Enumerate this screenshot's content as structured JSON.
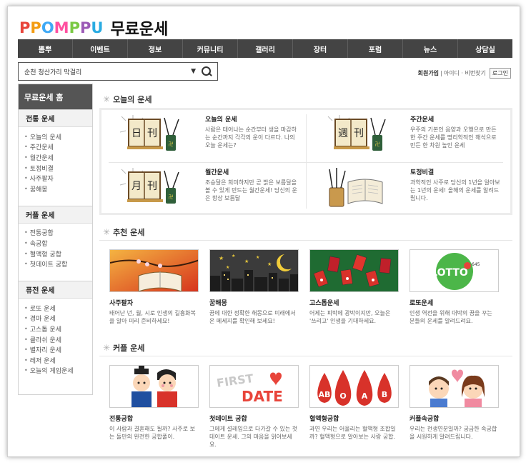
{
  "header": {
    "logo_letters": [
      "P",
      "P",
      "O",
      "M",
      "P",
      "P",
      "U"
    ],
    "logo_colors": [
      "#e8443a",
      "#f39c12",
      "#3fa9f5",
      "#ff4fa0",
      "#7ac943",
      "#9b59b6",
      "#29abe2"
    ],
    "site_title": "무료운세"
  },
  "nav": [
    "뽐뿌",
    "이벤트",
    "정보",
    "커뮤니티",
    "갤러리",
    "장터",
    "포럼",
    "뉴스",
    "상담실"
  ],
  "search": {
    "value": "순천 청산가리 막걸리"
  },
  "member": {
    "join": "회원가입",
    "find": "아이디 · 비번찾기",
    "login": "로그인"
  },
  "sidebar": {
    "home": "무료운세 홈",
    "groups": [
      {
        "title": "전통 운세",
        "items": [
          "오늘의 운세",
          "주간운세",
          "월간운세",
          "토정비결",
          "사주팔자",
          "꿈해몽"
        ]
      },
      {
        "title": "커플 운세",
        "items": [
          "전통궁합",
          "속궁합",
          "혈액형 궁합",
          "첫데이트 궁합"
        ]
      },
      {
        "title": "퓨전 운세",
        "items": [
          "로또 운세",
          "경마 운세",
          "고스톱 운세",
          "클라쉬 운세",
          "별자리 운세",
          "레저 운세",
          "오늘의 게임운세"
        ]
      }
    ]
  },
  "sections": {
    "today": "오늘의 운세",
    "recommend": "추천 운세",
    "couple": "커플 운세"
  },
  "today": [
    {
      "name": "오늘의 운세",
      "desc": "사람은 태어나는 순간부터 생을 마감하는 순간까지 각각의 운이 다르다. 나의 오늘 운세는?",
      "chars": [
        "日",
        "刊"
      ]
    },
    {
      "name": "주간운세",
      "desc": "우주의 기본인 음양과 오행으로 만든 한 주간 운세를 명리학적인 해석으로 만든 한 차원 높인 운세",
      "chars": [
        "週",
        "刊"
      ]
    },
    {
      "name": "월간운세",
      "desc": "조승달은 희미하지만 곧 밝은 보름달을 볼 수 있게 만드는 월간운세! 당신의 운은 항상 보름달",
      "chars": [
        "月",
        "刊"
      ]
    },
    {
      "name": "토정비결",
      "desc": "과학적인 사주로 당신의 1년을 알아보는 1년의 운세! 올해의 운세를 알려드립니다.",
      "chars": []
    }
  ],
  "recommend": [
    {
      "name": "사주팔자",
      "desc": "태어난 년, 월, 시로 인생의 길흉화복을 알아 미리 준비하세요!"
    },
    {
      "name": "꿈해몽",
      "desc": "꿈에 대한 정확한 해몽으로 미래에서 온 메세지를 확인해 보세요!"
    },
    {
      "name": "고스톱운세",
      "desc": "어제는 피박에 광박이지만, 오늘은 '쓰리고' 인생을 기대하세요."
    },
    {
      "name": "로또운세",
      "desc": "인생 역전을 위해 대박의 꿈을 꾸는 분들의 운세를 알려드려요."
    }
  ],
  "recommend_thumb_text": {
    "lotto": "LOTTO",
    "lotto_num": "645"
  },
  "couple": [
    {
      "name": "전통궁합",
      "desc": "이 사람과 결혼해도 될까? 사주로 보는 둘만의 완전한 궁합풀이."
    },
    {
      "name": "첫데이트 궁합",
      "desc": "그에게 설레임으로 다가갈 수 있는 첫 데이트 운세. 그의 마음을 읽어보세요."
    },
    {
      "name": "혈액형궁합",
      "desc": "과연 우리는 어울리는 혈액형 조합일까? 혈액형으로 알아보는 사랑 궁합."
    },
    {
      "name": "커플속궁합",
      "desc": "우리는 천생연분일까? 궁금한 속궁합을 시원하게 알려드립니다."
    }
  ],
  "couple_thumb_text": {
    "first": "FIRST",
    "date": "DATE",
    "blood": [
      "AB",
      "O",
      "A",
      "B"
    ]
  }
}
